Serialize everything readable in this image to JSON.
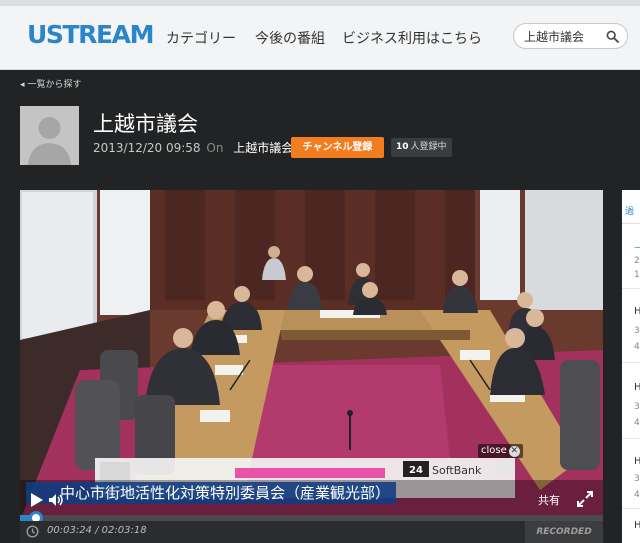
{
  "header": {
    "logo": "USTREAM",
    "nav": [
      "カテゴリー",
      "今後の番組",
      "ビジネス利用はこちら"
    ],
    "search_value": "上越市議会"
  },
  "channel": {
    "back_label": "一覧から探す",
    "title": "上越市議会",
    "date": "2013/12/20 09:58",
    "on_label": "On",
    "channel_name": "上越市議会",
    "subscribe_label": "チャンネル登録",
    "subscriber_count": "10",
    "subscriber_suffix": "人登録中"
  },
  "player": {
    "ad_text": "SoftBank",
    "ad_number": "24",
    "close_label": "close",
    "caption": "中心市街地活性化対策特別委員会（産業観光部）",
    "share_label": "共有",
    "progress_fraction": 0.028,
    "elapsed": "00:03:24",
    "duration": "02:03:18",
    "recorded_label": "RECORDED LIVE"
  },
  "sidepanel": {
    "tab_label": "過",
    "rows": [
      "—",
      "2",
      "1",
      "H",
      "3",
      "4",
      "H",
      "3",
      "4",
      "H",
      "3",
      "4",
      "H",
      "3",
      "4"
    ]
  },
  "colors": {
    "brand_blue": "#2a86c9",
    "subscribe_orange": "#f27d1f",
    "page_dark": "#222324",
    "caption_blue": "#103e82"
  },
  "icons": {
    "search": "search-icon",
    "play": "play-icon",
    "volume": "volume-icon",
    "fullscreen": "fullscreen-icon",
    "clock": "clock-icon",
    "avatar": "avatar-placeholder-icon"
  }
}
